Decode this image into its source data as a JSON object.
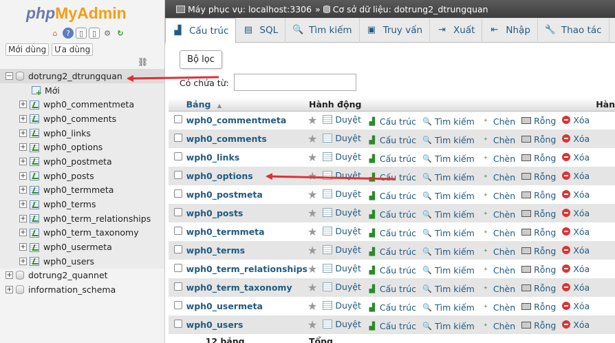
{
  "logo": {
    "php": "php",
    "my": "My",
    "admin": "Admin"
  },
  "nav": {
    "recent_btn": "Mới dùng",
    "favorite_btn": "Ưa dùng",
    "tree": {
      "active_db": "dotrung2_dtrungquan",
      "new_label": "Mới",
      "tables": [
        "wph0_commentmeta",
        "wph0_comments",
        "wph0_links",
        "wph0_options",
        "wph0_postmeta",
        "wph0_posts",
        "wph0_termmeta",
        "wph0_terms",
        "wph0_term_relationships",
        "wph0_term_taxonomy",
        "wph0_usermeta",
        "wph0_users"
      ],
      "other_dbs": [
        "dotrung2_quannet",
        "information_schema"
      ]
    }
  },
  "breadcrumb": {
    "server": "Máy phục vụ: localhost:3306",
    "sep": "»",
    "database": "Cơ sở dữ liệu: dotrung2_dtrungquan"
  },
  "tabs": [
    {
      "label": "Cấu trúc",
      "icon": "structure-icon",
      "glyph": "▟"
    },
    {
      "label": "SQL",
      "icon": "sql-icon",
      "glyph": "▤"
    },
    {
      "label": "Tìm kiếm",
      "icon": "search-icon",
      "glyph": "🔍"
    },
    {
      "label": "Truy vấn",
      "icon": "query-icon",
      "glyph": "▣"
    },
    {
      "label": "Xuất",
      "icon": "export-icon",
      "glyph": "⇥"
    },
    {
      "label": "Nhập",
      "icon": "import-icon",
      "glyph": "⇤"
    },
    {
      "label": "Thao tác",
      "icon": "operations-icon",
      "glyph": "🔧"
    }
  ],
  "filter": {
    "title": "Bộ lọc",
    "label": "Có chứa từ:",
    "value": ""
  },
  "table": {
    "col_table": "Bảng",
    "sort_indicator": "▲",
    "col_action": "Hành động",
    "col_more": "Hàn",
    "actions": {
      "browse": "Duyệt",
      "structure": "Cấu trúc",
      "search": "Tìm kiếm",
      "insert": "Chèn",
      "empty": "Rỗng",
      "drop": "Xóa"
    },
    "footer_count": "12 bảng",
    "footer_total": "Tổng"
  },
  "colors": {
    "link": "#235a81",
    "arrow": "#e03030",
    "topbar": "#4a4a4a"
  }
}
